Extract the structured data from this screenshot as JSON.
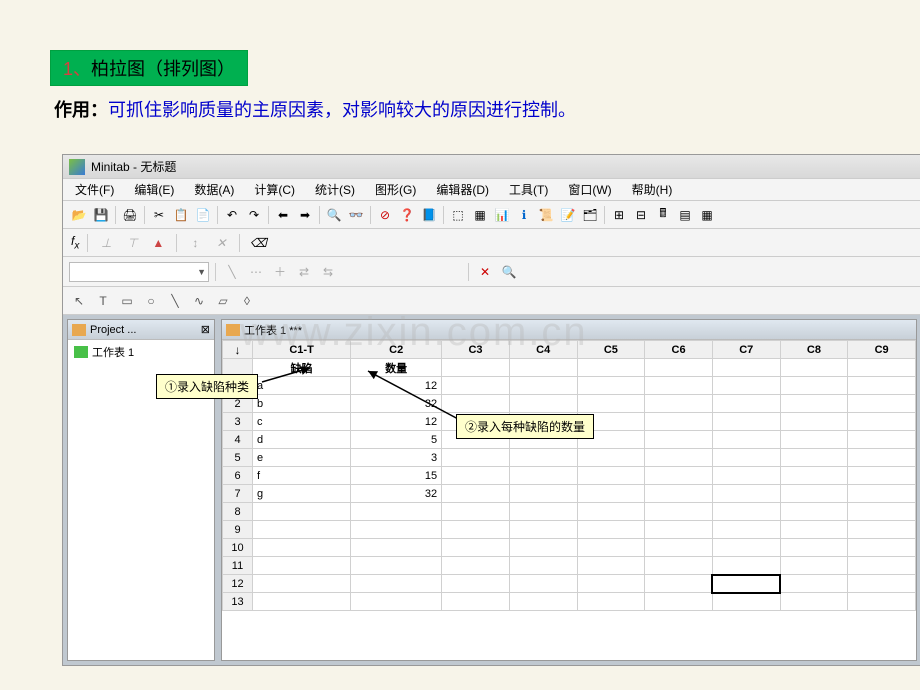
{
  "slide": {
    "title_num": "1、",
    "title_text": "柏拉图（排列图）",
    "desc_label": "作用：",
    "desc_text": "可抓住影响质量的主原因素，对影响较大的原因进行控制。"
  },
  "app": {
    "title": "Minitab - 无标题"
  },
  "menu": {
    "file": "文件(F)",
    "edit": "编辑(E)",
    "data": "数据(A)",
    "calc": "计算(C)",
    "stat": "统计(S)",
    "graph": "图形(G)",
    "editor": "编辑器(D)",
    "tools": "工具(T)",
    "window": "窗口(W)",
    "help": "帮助(H)"
  },
  "formula_label": "f",
  "project_panel": {
    "title": "Project ...",
    "item": "工作表 1"
  },
  "worksheet": {
    "title": "工作表 1 ***",
    "columns": [
      "C1-T",
      "C2",
      "C3",
      "C4",
      "C5",
      "C6",
      "C7",
      "C8",
      "C9"
    ],
    "headers": {
      "c1": "缺陷",
      "c2": "数量"
    }
  },
  "chart_data": {
    "type": "table",
    "categories": [
      "a",
      "b",
      "c",
      "d",
      "e",
      "f",
      "g"
    ],
    "values": [
      12,
      32,
      12,
      5,
      3,
      15,
      32
    ],
    "xlabel": "缺陷",
    "ylabel": "数量"
  },
  "annotations": {
    "a1": "①录入缺陷种类",
    "a2": "②录入每种缺陷的数量"
  },
  "watermark": "www.zixin.com.cn"
}
